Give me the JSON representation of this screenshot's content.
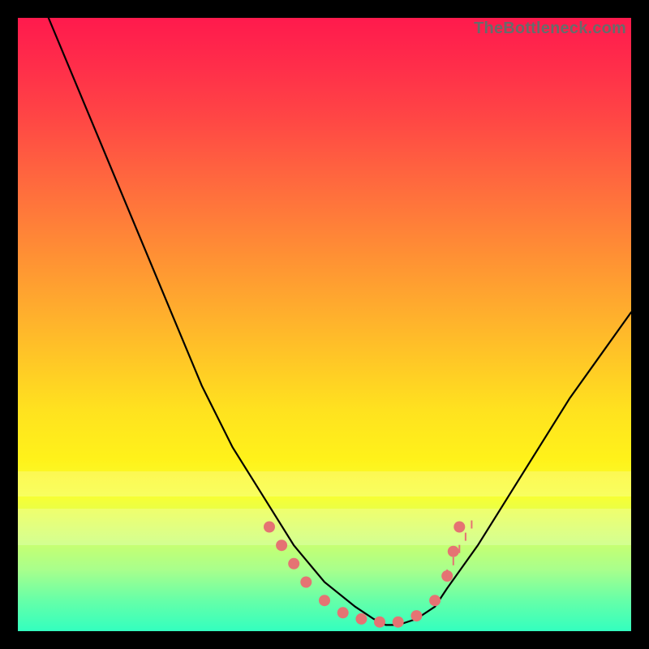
{
  "watermark": "TheBottleneck.com",
  "chart_data": {
    "type": "line",
    "title": "",
    "xlabel": "",
    "ylabel": "",
    "xlim": [
      0,
      100
    ],
    "ylim": [
      0,
      100
    ],
    "series": [
      {
        "name": "bottleneck-curve",
        "x": [
          5,
          10,
          15,
          20,
          25,
          30,
          35,
          40,
          45,
          50,
          55,
          58,
          60,
          62,
          65,
          68,
          70,
          75,
          80,
          85,
          90,
          95,
          100
        ],
        "y": [
          100,
          88,
          76,
          64,
          52,
          40,
          30,
          22,
          14,
          8,
          4,
          2,
          1,
          1,
          2,
          4,
          7,
          14,
          22,
          30,
          38,
          45,
          52
        ]
      }
    ],
    "markers": {
      "name": "highlight-dots",
      "x": [
        41,
        43,
        45,
        47,
        50,
        53,
        56,
        59,
        62,
        65,
        68,
        70,
        71,
        72
      ],
      "y": [
        17,
        14,
        11,
        8,
        5,
        3,
        2,
        1.5,
        1.5,
        2.5,
        5,
        9,
        13,
        17
      ]
    },
    "tick_marks": {
      "name": "right-arm-ticks",
      "x": [
        70,
        71,
        72,
        73,
        74
      ],
      "y": [
        9,
        11,
        13,
        15,
        17
      ]
    },
    "haze_bands": [
      {
        "y_from": 74,
        "y_to": 78
      },
      {
        "y_from": 80,
        "y_to": 86
      }
    ],
    "colors": {
      "gradient_top": "#ff1a4d",
      "gradient_bottom": "#33ffbf",
      "curve": "#000000",
      "marker": "#e57373",
      "frame": "#000000"
    }
  }
}
